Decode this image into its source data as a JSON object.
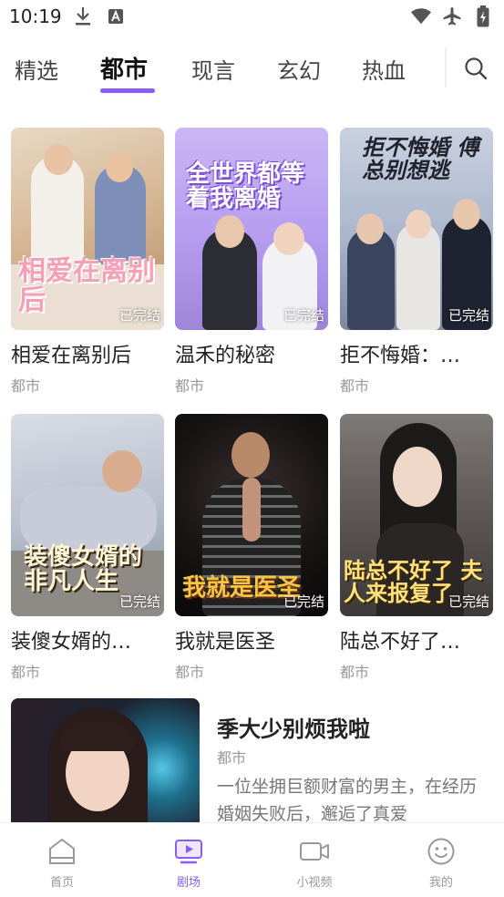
{
  "status_bar": {
    "time": "10:19"
  },
  "tabs": [
    {
      "label": "精选"
    },
    {
      "label": "都市"
    },
    {
      "label": "现言"
    },
    {
      "label": "玄幻"
    },
    {
      "label": "热血"
    }
  ],
  "active_tab": "都市",
  "colors": {
    "accent": "#8b5cf6",
    "title": "#222222",
    "muted": "#999999"
  },
  "cards": [
    {
      "title": "相爱在离别后",
      "genre": "都市",
      "badge": "已完结",
      "cover_text": "相爱在离别后"
    },
    {
      "title": "温禾的秘密",
      "genre": "都市",
      "badge": "已完结",
      "cover_text": "全世界都等着我离婚"
    },
    {
      "title": "拒不悔婚：…",
      "genre": "都市",
      "badge": "已完结",
      "cover_text": "拒不悔婚 傅总别想逃"
    },
    {
      "title": "装傻女婿的…",
      "genre": "都市",
      "badge": "已完结",
      "cover_text": "装傻女婿的非凡人生"
    },
    {
      "title": "我就是医圣",
      "genre": "都市",
      "badge": "已完结",
      "cover_text": "我就是医圣"
    },
    {
      "title": "陆总不好了…",
      "genre": "都市",
      "badge": "已完结",
      "cover_text": "陆总不好了 夫人来报复了"
    }
  ],
  "feature": {
    "title": "季大少别烦我啦",
    "genre": "都市",
    "description": "一位坐拥巨额财富的男主，在经历婚姻失败后，邂逅了真爱"
  },
  "bottom_nav": [
    {
      "label": "首页",
      "icon": "home-icon"
    },
    {
      "label": "剧场",
      "icon": "theater-icon"
    },
    {
      "label": "小视频",
      "icon": "video-camera-icon"
    },
    {
      "label": "我的",
      "icon": "smiley-face-icon"
    }
  ]
}
